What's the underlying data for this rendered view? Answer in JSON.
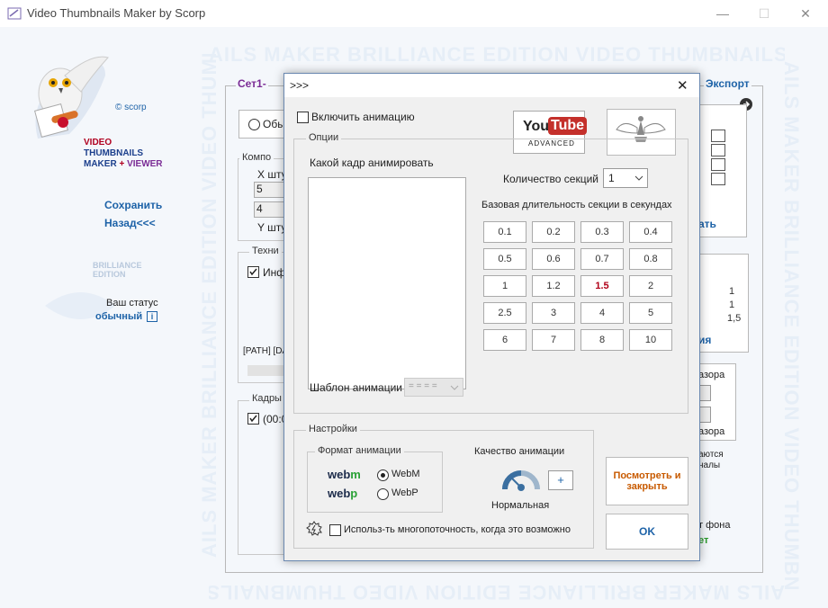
{
  "window": {
    "title": "Video Thumbnails Maker by Scorp",
    "minimize": "—",
    "maximize": "☐",
    "close": "✕"
  },
  "watermark": "AILS MAKER BRILLIANCE EDITION VIDEO THUMBNAILS MAKER BRILLIANCE EDITION",
  "sidebar": {
    "copyright": "© scorp",
    "brand_line1": "VIDEO",
    "brand_line2": "THUMBNAILS",
    "brand_line3a": "MAKER",
    "brand_line3b": "+",
    "brand_line3c": "VIEWER",
    "save": "Сохранить",
    "back": "Назад<<<",
    "edition_line1": "BRILLIANCE",
    "edition_line2": "EDITION",
    "status_label": "Ваш статус",
    "status_value": "обычный",
    "status_icon": "i"
  },
  "main": {
    "set_tab": "Сет1-",
    "export_tab": "Экспорт",
    "radio_partial": "Обы",
    "components_partial": "Компо",
    "x_count_partial": "Х шту",
    "x_value": "5",
    "x_value2": "4",
    "y_count_partial": "Y шту",
    "tech_partial": "Техни",
    "info_partial": "Инф",
    "path_text": "[PATH] [DA",
    "frames_partial": "Кадры",
    "frames_time": "(00:0",
    "right_numbers": [
      "1",
      "1",
      "1,5"
    ],
    "right_link_partial": "ать",
    "right_link2_partial": "ия",
    "gap_label1": "азора",
    "gap_label2": "азора",
    "note_partial1": "аются",
    "note_partial2": "налы",
    "bg_partial": "т фона",
    "bg_green_partial": "ет"
  },
  "dialog": {
    "title": ">>>",
    "close": "✕",
    "enable_animation": "Включить анимацию",
    "options_legend": "Опции",
    "which_frame": "Какой кадр анимировать",
    "sections_count_label": "Количество секций",
    "sections_count_value": "1",
    "base_duration_label": "Базовая длительность секции в секундах",
    "durations": [
      "0.1",
      "0.2",
      "0.3",
      "0.4",
      "0.5",
      "0.6",
      "0.7",
      "0.8",
      "1",
      "1.2",
      "1.5",
      "2",
      "2.5",
      "3",
      "4",
      "5",
      "6",
      "7",
      "8",
      "10"
    ],
    "selected_duration": "1.5",
    "template_label": "Шаблон анимации",
    "template_value": "= = = =",
    "youtube_you": "You",
    "youtube_tube": "Tube",
    "youtube_sub": "ADVANCED",
    "settings_legend": "Настройки",
    "format_legend": "Формат анимации",
    "webm_logo_a": "web",
    "webm_logo_b": "m",
    "webp_logo_a": "web",
    "webp_logo_b": "p",
    "webm_label": "WebM",
    "webp_label": "WebP",
    "quality_label": "Качество анимации",
    "quality_plus": "+",
    "quality_value": "Нормальная",
    "multithread_label": "Использ-ть многопоточность, когда это возможно",
    "preview_close_line1": "Посмотреть и",
    "preview_close_line2": "закрыть",
    "ok": "OK",
    "colors": {
      "accent": "#c85a00",
      "selected": "#b00018",
      "link": "#1e63a8"
    }
  }
}
